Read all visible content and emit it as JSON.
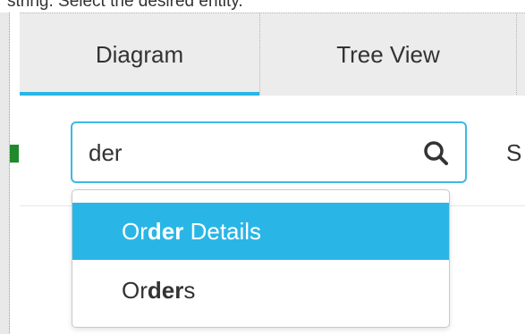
{
  "caption": "string. Select the desired entity.",
  "tabs": [
    {
      "label": "Diagram",
      "active": true
    },
    {
      "label": "Tree View",
      "active": false
    }
  ],
  "search": {
    "value": "der",
    "icon": "search-icon"
  },
  "next_label": "S",
  "suggestions": [
    {
      "pre": "Or",
      "match": "der",
      "post": " Details",
      "highlighted": true
    },
    {
      "pre": "Or",
      "match": "der",
      "post": "s",
      "highlighted": false
    }
  ],
  "colors": {
    "accent": "#29b6e6",
    "input_border": "#3eb8e2",
    "tab_bg": "#ececec",
    "left_accent": "#1f8a2a"
  }
}
